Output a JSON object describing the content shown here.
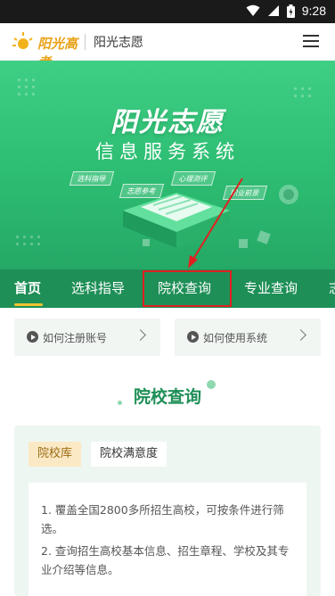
{
  "status_bar": {
    "time": "9:28"
  },
  "header": {
    "logo_text": "阳光高考",
    "title": "阳光志愿",
    "menu_icon": "hamburger-menu-icon"
  },
  "banner": {
    "title": "阳光志愿",
    "subtitle": "信息服务系统",
    "tags": [
      "选科指导",
      "志愿参考",
      "心理测评",
      "职业前景"
    ]
  },
  "nav": {
    "items": [
      "首页",
      "选科指导",
      "院校查询",
      "专业查询",
      "志"
    ],
    "active_index": 0
  },
  "quick_links": [
    {
      "label": "如何注册账号"
    },
    {
      "label": "如何使用系统"
    }
  ],
  "section": {
    "title": "院校查询"
  },
  "card": {
    "tabs": [
      "院校库",
      "院校满意度"
    ],
    "active_tab": 0,
    "paragraphs": [
      "1. 覆盖全国2800多所招生高校，可按条件进行筛选。",
      "2. 查询招生高校基本信息、招生章程、学校及其专业介绍等信息。"
    ]
  },
  "colors": {
    "brand_green": "#1e8f57",
    "banner_green": "#3fcf84",
    "highlight_red": "#e02020",
    "active_tab_bg": "#fbe9c6"
  }
}
